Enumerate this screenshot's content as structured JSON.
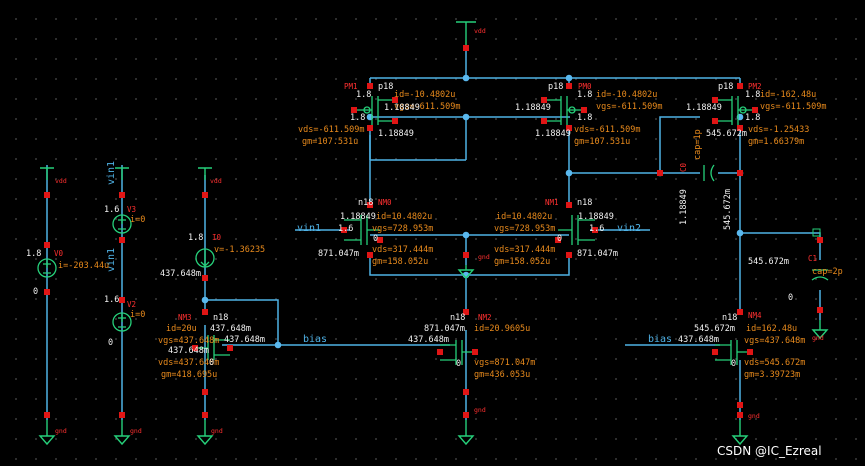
{
  "colors": {
    "background": "#000000",
    "wire": "#4fb2e6",
    "device": "#26d07a",
    "pin": "#e01515",
    "op_text": "#e88a1c",
    "name_text": "#ff3030",
    "value_text": "#f2f2f2",
    "grid": "#3a3a3a"
  },
  "watermark": "CSDN @IC_Ezreal",
  "nets": {
    "vdd": "vdd",
    "gnd": "gnd",
    "vin1": "vin1",
    "vin2": "vin2",
    "bias": "bias",
    "bias_right": "bias"
  },
  "sources": {
    "v0": {
      "name": "V0",
      "line": "i=-203.44u",
      "top": "1.8",
      "bottom": "0",
      "top_label": "vdd",
      "bottom_label": "gnd"
    },
    "v3": {
      "name": "V3",
      "line": "i=0",
      "left": "1.6",
      "top_label": "vin1",
      "bottom_label": "vin1"
    },
    "v2": {
      "name": "V2",
      "line": "i=0",
      "top": "1.6",
      "bottom": "0",
      "bottom_label": "gnd"
    },
    "i0": {
      "name": "I0",
      "line": "v=-1.36235",
      "left": "1.8",
      "bottom": "437.648m",
      "top_label": "vdd",
      "bottom_label": "gnd"
    }
  },
  "devices": {
    "pm1": {
      "name": "PM1",
      "type": "p18",
      "ops": [
        "id=-10.4802u",
        "vgs=-611.509m",
        "vds=-611.509m",
        "gm=107.531u"
      ],
      "nodes": [
        "1.8",
        "1.8",
        "1.18849",
        "1.18849",
        "1.8"
      ]
    },
    "pm0": {
      "name": "PM0",
      "type": "p18",
      "ops": [
        "id=-10.4802u",
        "vgs=-611.509m",
        "vds=-611.509m",
        "gm=107.531u"
      ],
      "nodes": [
        "1.8",
        "1.8",
        "1.18849",
        "1.18849",
        "1.8"
      ]
    },
    "pm2": {
      "name": "PM2",
      "type": "p18",
      "ops": [
        "id=-162.48u",
        "vgs=-611.509m",
        "vds=-1.25433",
        "gm=1.66379m"
      ],
      "nodes": [
        "1.8",
        "1.8",
        "1.18849",
        "545.672m",
        "1.8"
      ]
    },
    "nm0": {
      "name": "NM0",
      "type": "n18",
      "ops": [
        "id=10.4802u",
        "vgs=728.953m",
        "vds=317.444m",
        "gm=158.052u"
      ],
      "nodes": [
        "1.18849",
        "1.6",
        "0",
        "871.047m"
      ]
    },
    "nm1": {
      "name": "NM1",
      "type": "n18",
      "ops": [
        "id=10.4802u",
        "vgs=728.953m",
        "vds=317.444m",
        "gm=158.052u"
      ],
      "nodes": [
        "1.18849",
        "1.6",
        "0",
        "871.047m"
      ]
    },
    "nm3": {
      "name": "NM3",
      "type": "n18",
      "ops": [
        "id=20u",
        "vgs=437.648m",
        "vds=437.648m",
        "gm=418.695u"
      ],
      "nodes": [
        "437.648m",
        "437.648m",
        "437.648m",
        "0"
      ]
    },
    "nm2": {
      "name": "NM2",
      "type": "n18",
      "ops": [
        "id=20.9605u",
        "vgs=871.047m",
        "gm=436.053u"
      ],
      "nodes": [
        "871.047m",
        "437.648m",
        "0"
      ]
    },
    "nm4": {
      "name": "NM4",
      "type": "n18",
      "ops": [
        "id=162.48u",
        "vgs=437.648m",
        "vds=545.672m",
        "gm=3.39723m"
      ],
      "nodes": [
        "545.672m",
        "437.648m",
        "0"
      ]
    }
  },
  "caps": {
    "c0": {
      "name": "C0",
      "line": "cap=1p",
      "left": "1.18849",
      "right": "545.672m"
    },
    "c1": {
      "name": "C1",
      "line": "cap=2p",
      "top": "545.672m",
      "bottom": "0",
      "bottom_label": "gnd"
    }
  },
  "gnd_labels": {
    "nm0": "gnd",
    "nm2": "gnd",
    "nm4": "gnd",
    "v2": "gnd",
    "i0": "gnd"
  }
}
